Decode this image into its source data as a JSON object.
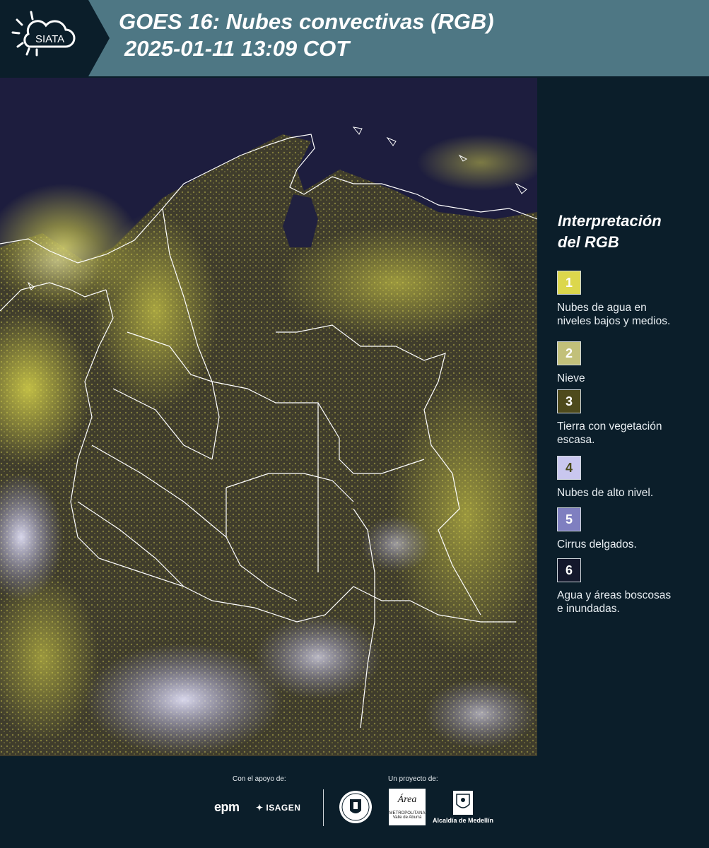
{
  "header": {
    "logo_text": "SIATA",
    "title_line1": "GOES 16: Nubes convectivas (RGB)",
    "title_line2": "2025-01-11 13:09 COT",
    "background_color": "#4e7784",
    "logo_panel_color": "#0b1e2a"
  },
  "legend": {
    "title_line1": "Interpretación",
    "title_line2": "del RGB",
    "items": [
      {
        "number": "1",
        "label_line1": "Nubes de agua en",
        "label_line2": "niveles bajos y medios.",
        "color": "#dcd74c"
      },
      {
        "number": "2",
        "label_line1": "Nieve",
        "label_line2": "",
        "color": "#c2c07a"
      },
      {
        "number": "3",
        "label_line1": "Tierra con vegetación",
        "label_line2": "escasa.",
        "color": "#4e4a1c"
      },
      {
        "number": "4",
        "label_line1": "Nubes de alto nivel.",
        "label_line2": "",
        "color": "#c9c7ef"
      },
      {
        "number": "5",
        "label_line1": "Cirrus delgados.",
        "label_line2": "",
        "color": "#7f7fc0"
      },
      {
        "number": "6",
        "label_line1": "Agua y áreas boscosas",
        "label_line2": "e inundadas.",
        "color": "#14182c"
      }
    ]
  },
  "footer": {
    "support_label": "Con el apoyo de:",
    "project_label": "Un proyecto de:",
    "epm_text": "epm",
    "isagen_text": "ISAGEN",
    "area_text": "Área",
    "area_sub": "METROPOLITANA Valle de Aburrá",
    "alcaldia_text": "Alcaldía de Medellín"
  },
  "map": {
    "background_color": "#1d1d3e",
    "land_color": "#3a3a2a",
    "cloud_low_color": "#d8d44a",
    "cloud_high_color": "#c9c7ef",
    "border_color": "#ffffff"
  }
}
